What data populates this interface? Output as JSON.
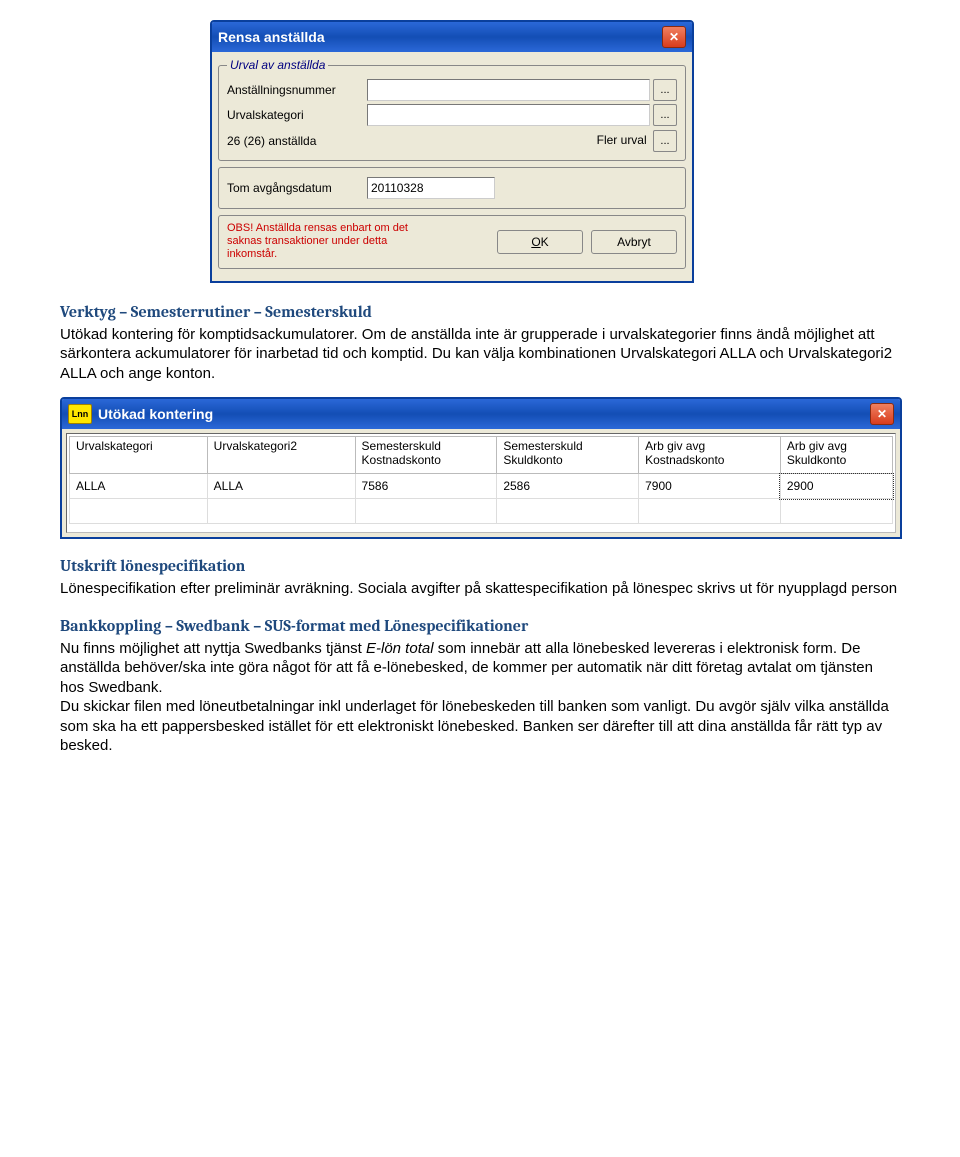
{
  "dialog1": {
    "title": "Rensa anställda",
    "group_legend": "Urval av anställda",
    "employee_no_label": "Anställningsnummer",
    "category_label": "Urvalskategori",
    "count_text": "26 (26) anställda",
    "more_selection_label": "Fler urval",
    "date_label": "Tom avgångsdatum",
    "date_value": "20110328",
    "warning": "OBS! Anställda rensas enbart om det saknas transaktioner under detta inkomstår.",
    "ok_btn": "OK",
    "cancel_btn": "Avbryt",
    "dots": "..."
  },
  "section1": {
    "heading": "Verktyg – Semesterrutiner – Semesterskuld",
    "body": "Utökad kontering för komptidsackumulatorer. Om de anställda inte är grupperade i urvalskategorier finns ändå möjlighet att särkontera ackumulatorer för inarbetad tid och komptid. Du kan välja kombinationen Urvalskategori ALLA och Urvalskategori2 ALLA och ange konton."
  },
  "dialog2": {
    "icon_text": "Lnn",
    "title": "Utökad kontering",
    "headers": [
      [
        "",
        "",
        "Semesterskuld",
        "Semesterskuld",
        "Arb giv avg",
        "Arb giv avg"
      ],
      [
        "Urvalskategori",
        "Urvalskategori2",
        "Kostnadskonto",
        "Skuldkonto",
        "Kostnadskonto",
        "Skuldkonto"
      ]
    ],
    "row": [
      "ALLA",
      "ALLA",
      "7586",
      "2586",
      "7900",
      "2900"
    ]
  },
  "section2": {
    "heading": "Utskrift lönespecifikation",
    "body": "Lönespecifikation efter preliminär avräkning. Sociala avgifter på skattespecifikation på lönespec skrivs ut för nyupplagd person"
  },
  "section3": {
    "heading": "Bankkoppling – Swedbank – SUS-format med Lönespecifikationer",
    "body": "Nu finns möjlighet att nyttja Swedbanks tjänst E-lön total som innebär att alla lönebesked levereras i elektronisk form. De anställda behöver/ska inte göra något för att få e-lönebesked, de kommer per automatik när ditt företag avtalat om tjänsten hos Swedbank.\nDu skickar filen med löneutbetalningar inkl underlaget för lönebeskeden till banken som vanligt. Du avgör själv vilka anställda som ska ha ett pappersbesked istället för ett elektroniskt lönebesked. Banken ser därefter till att dina anställda får rätt typ av besked."
  }
}
